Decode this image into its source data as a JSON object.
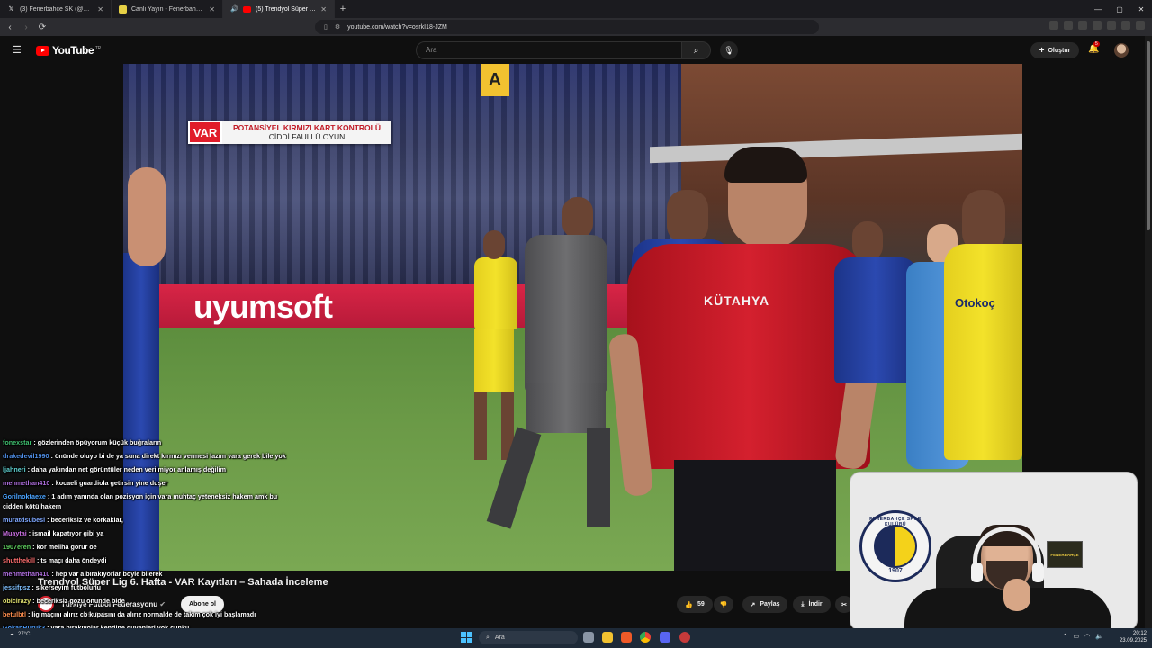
{
  "browser": {
    "tabs": [
      {
        "label": "(3) Fenerbahçe SK (@Fenerbahce) / X",
        "icon": "x-logo-icon",
        "active": false
      },
      {
        "label": "Canlı Yayın - Fenerbahçe Spor Kulübü",
        "icon": "fenerbahce-icon",
        "active": false
      },
      {
        "label": "(5) Trendyol Süper Lig 6. Hafta",
        "icon": "youtube-icon",
        "active": true
      }
    ],
    "new_tab": "+",
    "url": "youtube.com/watch?v=osrkI18-JZM",
    "window_controls": [
      "—",
      "▢",
      "✕"
    ]
  },
  "youtube": {
    "logo": "YouTube",
    "region": "TR",
    "search_placeholder": "Ara",
    "create_label": "Oluştur",
    "notification_count": "5"
  },
  "video": {
    "var_badge": "VAR",
    "var_line1": "POTANSİYEL KIRMIZI KART KONTROLÜ",
    "var_line2": "CİDDİ FAULLÜ OYUN",
    "board_text": "uyumsoft",
    "gate_letter": "A",
    "referee_shirt": "KÜTAHYA",
    "sponsor_shirt": "Otokoç",
    "title": "Trendyol Süper Lig 6. Hafta - VAR Kayıtları – Sahada İnceleme",
    "channel": "Türkiye Futbol Federasyonu",
    "subscribers": "468 B abone",
    "subscribe_label": "Abone ol",
    "likes": "59",
    "share_label": "Paylaş",
    "download_label": "İndir"
  },
  "chat": [
    {
      "user": "fonexstar",
      "color": "#3fbf6f",
      "text": "gözlerinden öpüyorum küçük buğraların"
    },
    {
      "user": "drakedevil1990",
      "color": "#4f8fe8",
      "text": "önünde oluyo bi de ya suna direkt kırmızı vermesi lazım vara gerek bile yok",
      "wrap": true
    },
    {
      "user": "ljahneri",
      "color": "#5fd0d0",
      "text": "daha yakından net görüntüler neden verilmiyor anlamış değilim"
    },
    {
      "user": "mehmethan410",
      "color": "#b06fe0",
      "text": "kocaeli guardiola getirsin yine duşer"
    },
    {
      "user": "Gorilnoktaexe",
      "color": "#4aa3ff",
      "text": "1 adım yanında olan pozisyon için vara muhtaç yeteneksiz hakem amk bu cidden kötü hakem",
      "wrap": true
    },
    {
      "user": "muratdsubesi",
      "color": "#7fa8ff",
      "text": "beceriksiz ve korkaklar,"
    },
    {
      "user": "Muaytai",
      "color": "#c86fe0",
      "text": "ismail kapatıyor gibi ya"
    },
    {
      "user": "1907eren",
      "color": "#5fd05f",
      "text": "kör meliha görür oe"
    },
    {
      "user": "shutthekill",
      "color": "#ff6f6f",
      "text": "ts maçı daha öndeydi"
    },
    {
      "user": "mehmethan410",
      "color": "#b06fe0",
      "text": "hep var a bırakıyorlar böyle bilerek"
    },
    {
      "user": "jessifpsz",
      "color": "#7fc0ff",
      "text": "sikerseyim futbolunu"
    },
    {
      "user": "obicirazy",
      "color": "#e0e06f",
      "text": "beceriksiz gözü önünde bide"
    },
    {
      "user": "betulbtl",
      "color": "#ff8f4f",
      "text": "lig maçını alırız cb kupasını da alırız normalde de takım çok iyi başlamadı"
    },
    {
      "user": "GokanBuruk3",
      "color": "#4f9fff",
      "text": "vara bırakıyolar kendine güvenleri yok cunku"
    }
  ],
  "webcam": {
    "emblem_ring": "FENERBAHÇE SPOR KULÜBÜ",
    "emblem_year": "1907",
    "sign": "FENERBAHÇE"
  },
  "taskbar": {
    "temperature": "27°C",
    "search_placeholder": "Ara",
    "time": "20:12",
    "date": "23.09.2025"
  }
}
